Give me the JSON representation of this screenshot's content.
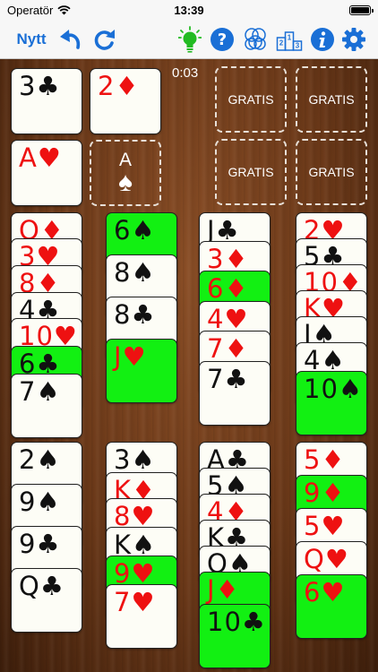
{
  "status": {
    "carrier": "Operatör",
    "time": "13:39"
  },
  "toolbar": {
    "new_label": "Nytt",
    "icons": [
      "undo-icon",
      "redo-icon",
      "hint-bulb-icon",
      "help-icon",
      "game-select-icon",
      "leaderboard-icon",
      "info-icon",
      "settings-gear-icon"
    ],
    "colors": {
      "blue": "#1a6fd6",
      "green": "#22bb22"
    }
  },
  "timer": "0:03",
  "suit_symbols": {
    "S": "♠",
    "H": "♥",
    "D": "♦",
    "C": "♣"
  },
  "top_cards": {
    "three_clubs": {
      "rank": "3",
      "suit": "♣",
      "color": "black"
    },
    "two_diamonds": {
      "rank": "2",
      "suit": "♦",
      "color": "red"
    },
    "ace_hearts": {
      "rank": "A",
      "suit": "♥",
      "color": "red"
    }
  },
  "ace_slot": {
    "rank": "A",
    "suit": "♠"
  },
  "free_cells": [
    "GRATIS",
    "GRATIS",
    "GRATIS",
    "GRATIS"
  ],
  "tableau": [
    [
      {
        "rank": "Q",
        "suit": "♦",
        "color": "red"
      },
      {
        "rank": "3",
        "suit": "♥",
        "color": "red"
      },
      {
        "rank": "8",
        "suit": "♦",
        "color": "red"
      },
      {
        "rank": "4",
        "suit": "♣",
        "color": "black"
      },
      {
        "rank": "10",
        "suit": "♥",
        "color": "red"
      },
      {
        "rank": "6",
        "suit": "♣",
        "color": "black",
        "highlight": true
      },
      {
        "rank": "7",
        "suit": "♠",
        "color": "black"
      }
    ],
    [
      {
        "rank": "6",
        "suit": "♠",
        "color": "black",
        "highlight": true
      },
      {
        "rank": "8",
        "suit": "♠",
        "color": "black"
      },
      {
        "rank": "8",
        "suit": "♣",
        "color": "black"
      },
      {
        "rank": "J",
        "suit": "♥",
        "color": "red",
        "highlight": true
      }
    ],
    [
      {
        "rank": "J",
        "suit": "♣",
        "color": "black"
      },
      {
        "rank": "3",
        "suit": "♦",
        "color": "red"
      },
      {
        "rank": "6",
        "suit": "♦",
        "color": "red",
        "highlight": true
      },
      {
        "rank": "4",
        "suit": "♥",
        "color": "red"
      },
      {
        "rank": "7",
        "suit": "♦",
        "color": "red"
      },
      {
        "rank": "7",
        "suit": "♣",
        "color": "black"
      }
    ],
    [
      {
        "rank": "2",
        "suit": "♥",
        "color": "red"
      },
      {
        "rank": "5",
        "suit": "♣",
        "color": "black"
      },
      {
        "rank": "10",
        "suit": "♦",
        "color": "red"
      },
      {
        "rank": "K",
        "suit": "♥",
        "color": "red"
      },
      {
        "rank": "J",
        "suit": "♠",
        "color": "black"
      },
      {
        "rank": "4",
        "suit": "♠",
        "color": "black"
      },
      {
        "rank": "10",
        "suit": "♠",
        "color": "black",
        "highlight": true
      }
    ],
    [
      {
        "rank": "2",
        "suit": "♠",
        "color": "black"
      },
      {
        "rank": "9",
        "suit": "♠",
        "color": "black"
      },
      {
        "rank": "9",
        "suit": "♣",
        "color": "black"
      },
      {
        "rank": "Q",
        "suit": "♣",
        "color": "black"
      }
    ],
    [
      {
        "rank": "3",
        "suit": "♠",
        "color": "black"
      },
      {
        "rank": "K",
        "suit": "♦",
        "color": "red"
      },
      {
        "rank": "8",
        "suit": "♥",
        "color": "red"
      },
      {
        "rank": "K",
        "suit": "♠",
        "color": "black"
      },
      {
        "rank": "9",
        "suit": "♥",
        "color": "red",
        "highlight": true
      },
      {
        "rank": "7",
        "suit": "♥",
        "color": "red"
      }
    ],
    [
      {
        "rank": "A",
        "suit": "♣",
        "color": "black"
      },
      {
        "rank": "5",
        "suit": "♠",
        "color": "black"
      },
      {
        "rank": "4",
        "suit": "♦",
        "color": "red"
      },
      {
        "rank": "K",
        "suit": "♣",
        "color": "black"
      },
      {
        "rank": "Q",
        "suit": "♠",
        "color": "black"
      },
      {
        "rank": "J",
        "suit": "♦",
        "color": "red",
        "highlight": true
      },
      {
        "rank": "10",
        "suit": "♣",
        "color": "black",
        "highlight": true
      }
    ],
    [
      {
        "rank": "5",
        "suit": "♦",
        "color": "red"
      },
      {
        "rank": "9",
        "suit": "♦",
        "color": "red",
        "highlight": true
      },
      {
        "rank": "5",
        "suit": "♥",
        "color": "red"
      },
      {
        "rank": "Q",
        "suit": "♥",
        "color": "red"
      },
      {
        "rank": "6",
        "suit": "♥",
        "color": "red",
        "highlight": true
      }
    ]
  ]
}
